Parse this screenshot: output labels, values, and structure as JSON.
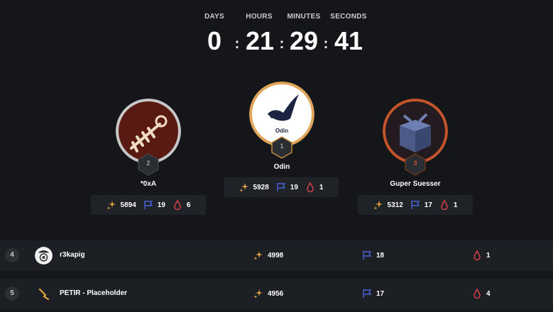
{
  "countdown": {
    "labels": {
      "days": "DAYS",
      "hours": "HOURS",
      "minutes": "MINUTES",
      "seconds": "SECONDS"
    },
    "values": {
      "days": "0",
      "hours": "21",
      "minutes": "29",
      "seconds": "41"
    },
    "separator": ":"
  },
  "podium": [
    {
      "rank": "2",
      "name": "*0xA",
      "points": "5894",
      "flags": "19",
      "bloods": "6",
      "ring_color": "#b9b9b9"
    },
    {
      "rank": "1",
      "name": "Odin",
      "avatar_text": "Odin",
      "points": "5928",
      "flags": "19",
      "bloods": "1",
      "ring_color": "#e0a45a"
    },
    {
      "rank": "3",
      "name": "Guper Suesser",
      "points": "5312",
      "flags": "17",
      "bloods": "1",
      "ring_color": "#c4552a"
    }
  ],
  "rows": [
    {
      "rank": "4",
      "name": "r3kapig",
      "points": "4998",
      "flags": "18",
      "bloods": "1"
    },
    {
      "rank": "5",
      "name": "PETIR - Placeholder",
      "points": "4956",
      "flags": "17",
      "bloods": "4"
    }
  ],
  "icons": {
    "points": "sparkle-icon",
    "flags": "flag-icon",
    "bloods": "blood-drop-icon"
  },
  "colors": {
    "background": "#141619",
    "card": "#1f2226",
    "points_icon": "#e3a440",
    "flag_icon": "#4a63d8",
    "blood_icon": "#e0414a"
  }
}
